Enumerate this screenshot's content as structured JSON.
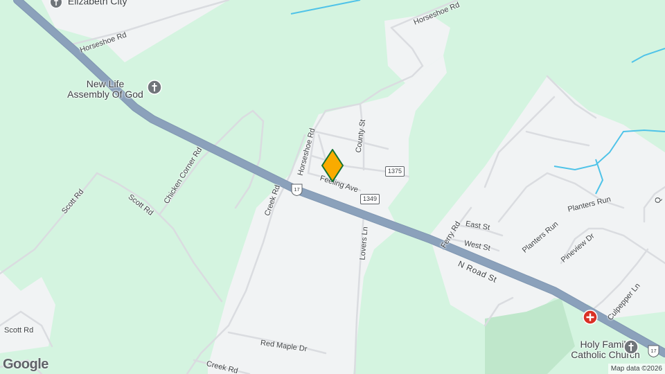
{
  "colors": {
    "background": "#d4f4e0",
    "urban": "#f1f3f4",
    "local_road": "#dadce0",
    "highway": "#8ba1bb",
    "water": "#4fc3e8",
    "park": "#bfe7cb",
    "marker_fill": "#f9ab00",
    "marker_stroke": "#137333",
    "church_icon": "#70757a",
    "hospital_icon": "#d93025"
  },
  "place_labels": {
    "elizabeth_city": "Elizabeth City",
    "new_life": "New Life\nAssembly Of God",
    "holy_family": "Holy Family\nCatholic Church"
  },
  "road_labels": {
    "horseshoe_rd_nw": "Horseshoe Rd",
    "horseshoe_rd_ne": "Horseshoe Rd",
    "horseshoe_rd_mid": "Horseshoe Rd",
    "county_st": "County St",
    "feeling_ave": "Feeling Ave",
    "chicken_corner_rd": "Chicken Corner Rd",
    "scott_rd_w": "Scott Rd",
    "scott_rd_mid": "Scott Rd",
    "scott_rd_sw": "Scott Rd",
    "creek_rd_n": "Creek Rd",
    "creek_rd_s": "Creek Rd",
    "lovers_ln": "Lovers Ln",
    "ferry_rd": "Ferry Rd",
    "east_st": "East St",
    "west_st": "West St",
    "planters_run_1": "Planters Run",
    "planters_run_2": "Planters Run",
    "pineview_dr": "Pineview Dr",
    "n_road_st": "N Road St",
    "culpepper_ln": "Culpepper Ln",
    "red_maple_dr": "Red Maple Dr",
    "q_cut": "Q"
  },
  "shields": {
    "sr_1375": "1375",
    "sr_1349": "1349",
    "us17_a": "17",
    "us17_b": "17"
  },
  "icons": {
    "church": "church-icon",
    "hospital": "hospital-icon",
    "marker": "location-pin-icon"
  },
  "footer": {
    "google_logo": "Google",
    "attribution": "Map data ©2026"
  }
}
